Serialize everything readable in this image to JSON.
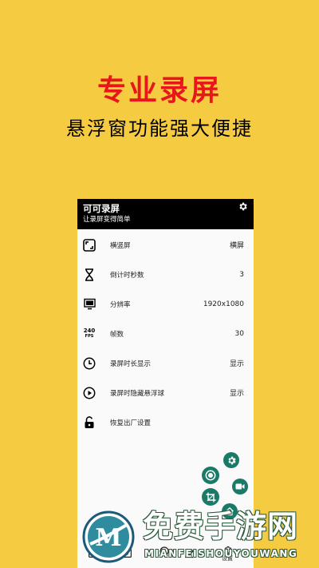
{
  "hero": {
    "title": "专业录屏",
    "subtitle": "悬浮窗功能强大便捷"
  },
  "app": {
    "title": "可可录屏",
    "subtitle": "让录屏变得简单",
    "settings": [
      {
        "icon": "screen-rotate-icon",
        "label": "横竖屏",
        "value": "横屏"
      },
      {
        "icon": "hourglass-icon",
        "label": "倒计时秒数",
        "value": "3"
      },
      {
        "icon": "monitor-icon",
        "label": "分辨率",
        "value": "1920x1080"
      },
      {
        "icon": "fps-icon",
        "label": "帧数",
        "value": "30"
      },
      {
        "icon": "clock-icon",
        "label": "录屏时长显示",
        "value": "显示"
      },
      {
        "icon": "play-circle-icon",
        "label": "录屏时隐藏悬浮球",
        "value": "显示"
      },
      {
        "icon": "unlock-icon",
        "label": "恢复出厂设置",
        "value": ""
      }
    ],
    "fps_icon_text": "240",
    "fps_icon_sub": "FPS",
    "bottom_nav": {
      "settings_label": "设置"
    }
  },
  "watermark": {
    "text": "免费手游网",
    "en": "MIANFEISHOUYOUWANG",
    "logo_letter": "M"
  },
  "colors": {
    "background": "#F5CB42",
    "hero_title": "#E8151B",
    "fab": "#1A7A68",
    "header": "#000000"
  }
}
